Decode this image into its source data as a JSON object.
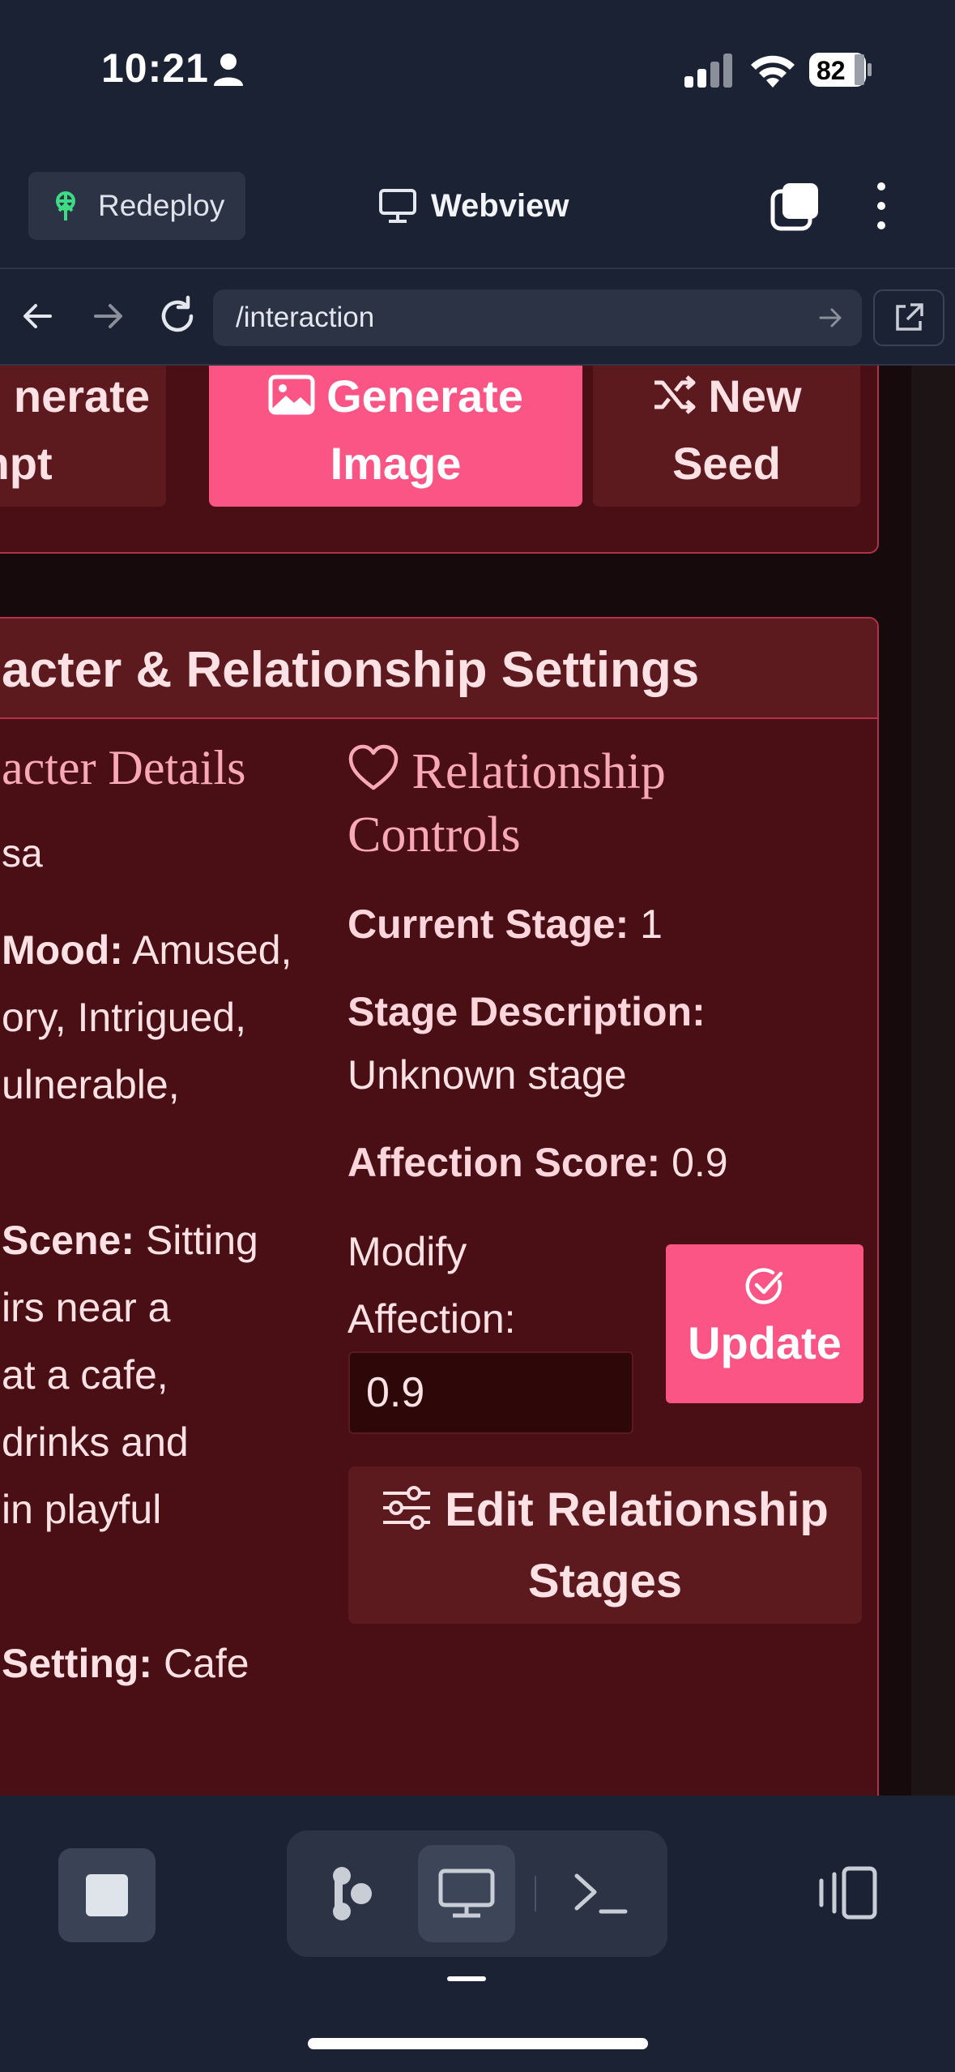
{
  "status_bar": {
    "time": "10:21",
    "battery": "82"
  },
  "header": {
    "redeploy_label": "Redeploy",
    "webview_label": "Webview"
  },
  "url_bar": {
    "path": "/interaction"
  },
  "actions": {
    "regenerate_prompt": [
      "nerate",
      "mpt"
    ],
    "generate_image": [
      "Generate",
      "Image"
    ],
    "new_seed": [
      "New",
      "Seed"
    ]
  },
  "settings": {
    "title": "acter & Relationship Settings",
    "character_details": {
      "title": "acter Details",
      "name": "sa",
      "mood_label": "Mood:",
      "mood_lines": [
        "Amused,",
        "ory, Intrigued,",
        "ulnerable,"
      ],
      "scene_label": "Scene:",
      "scene_lines": [
        "Sitting",
        "irs near a",
        "at a cafe,",
        "drinks and",
        "in playful"
      ],
      "setting_label": "Setting:",
      "setting_value": "Cafe"
    },
    "relationship": {
      "title_line1": "Relationship",
      "title_line2": "Controls",
      "current_stage_label": "Current Stage:",
      "current_stage_value": "1",
      "stage_description_label": "Stage Description:",
      "stage_description_value": "Unknown stage",
      "affection_score_label": "Affection Score:",
      "affection_score_value": "0.9",
      "modify_label_line1": "Modify",
      "modify_label_line2": "Affection:",
      "affection_input_value": "0.9",
      "update_label": "Update",
      "edit_stages_line1": "Edit Relationship",
      "edit_stages_line2": "Stages"
    }
  },
  "colors": {
    "accent": "#fb5586",
    "panel": "#4a0f14",
    "panel_border": "#b3324a",
    "app_bg": "#1b2233"
  },
  "icons": [
    "person-icon",
    "signal-icon",
    "wifi-icon",
    "battery-icon",
    "redeploy-icon",
    "monitor-icon",
    "tabs-icon",
    "more-icon",
    "back-icon",
    "forward-icon",
    "reload-icon",
    "arrow-right-icon",
    "external-link-icon",
    "image-icon",
    "shuffle-icon",
    "heart-icon",
    "check-circle-icon",
    "sliders-icon",
    "stop-icon",
    "agent-icon",
    "monitor-icon",
    "terminal-icon",
    "devices-icon"
  ]
}
